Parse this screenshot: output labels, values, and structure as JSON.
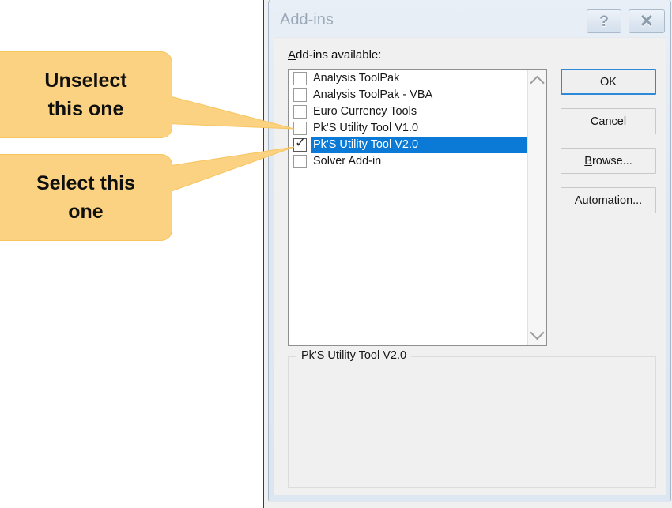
{
  "dialog": {
    "title": "Add-ins",
    "help_button": "?",
    "close_button": "✕",
    "available_label_prefix": "A",
    "available_label_rest": "dd-ins available:"
  },
  "list": {
    "items": [
      {
        "label": "Analysis ToolPak",
        "checked": false,
        "selected": false
      },
      {
        "label": "Analysis ToolPak - VBA",
        "checked": false,
        "selected": false
      },
      {
        "label": "Euro Currency Tools",
        "checked": false,
        "selected": false
      },
      {
        "label": "Pk'S Utility Tool V1.0",
        "checked": false,
        "selected": false
      },
      {
        "label": "Pk'S Utility Tool V2.0",
        "checked": true,
        "selected": true
      },
      {
        "label": "Solver Add-in",
        "checked": false,
        "selected": false
      }
    ],
    "check_glyph": "✓",
    "scroll_up": "▲",
    "scroll_down": "▼"
  },
  "buttons": {
    "ok": "OK",
    "cancel": "Cancel",
    "browse_accel": "B",
    "browse_rest": "rowse...",
    "automation_pre": "A",
    "automation_accel": "u",
    "automation_rest": "tomation..."
  },
  "description": {
    "legend": "Pk'S Utility Tool V2.0",
    "body": ""
  },
  "callouts": [
    {
      "line1": "Unselect",
      "line2": "this one"
    },
    {
      "line1": "Select this",
      "line2": "one"
    }
  ],
  "colors": {
    "callout_fill": "#fbd281",
    "callout_border": "#f7c55e",
    "selection_blue": "#0a7ad6",
    "dialog_face": "#f0f0f0",
    "titlebar": "#dce6f1",
    "default_button_border": "#2e8ad8"
  }
}
